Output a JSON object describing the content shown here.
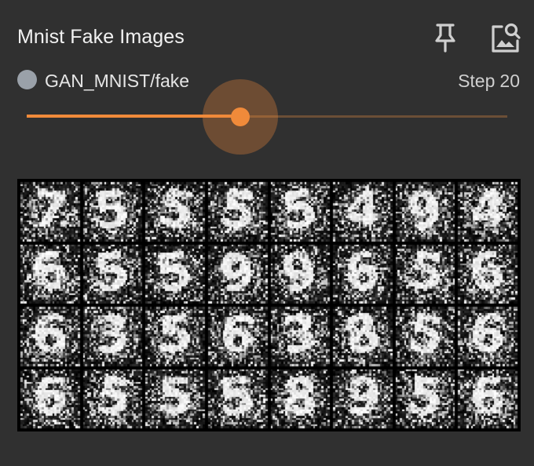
{
  "card": {
    "title": "Mnist Fake Images",
    "run_name": "GAN_MNIST/fake",
    "step_label": "Step",
    "step_value": 20,
    "accent_color": "#f08a3a",
    "run_color": "#9aa1a9"
  },
  "slider": {
    "value": 20,
    "fraction": 0.445
  },
  "actions": {
    "pin_icon": "pin-icon",
    "image_search_icon": "image-search-icon"
  },
  "image": {
    "grid_rows": 4,
    "grid_cols": 8,
    "digits": [
      "7",
      "5",
      "5",
      "5",
      "5",
      "4",
      "9",
      "4",
      "6",
      "5",
      "5",
      "9",
      "9",
      "6",
      "5",
      "6",
      "6",
      "3",
      "5",
      "6",
      "3",
      "8",
      "5",
      "6",
      "6",
      "5",
      "5",
      "5",
      "8",
      "9",
      "5",
      "6"
    ]
  }
}
